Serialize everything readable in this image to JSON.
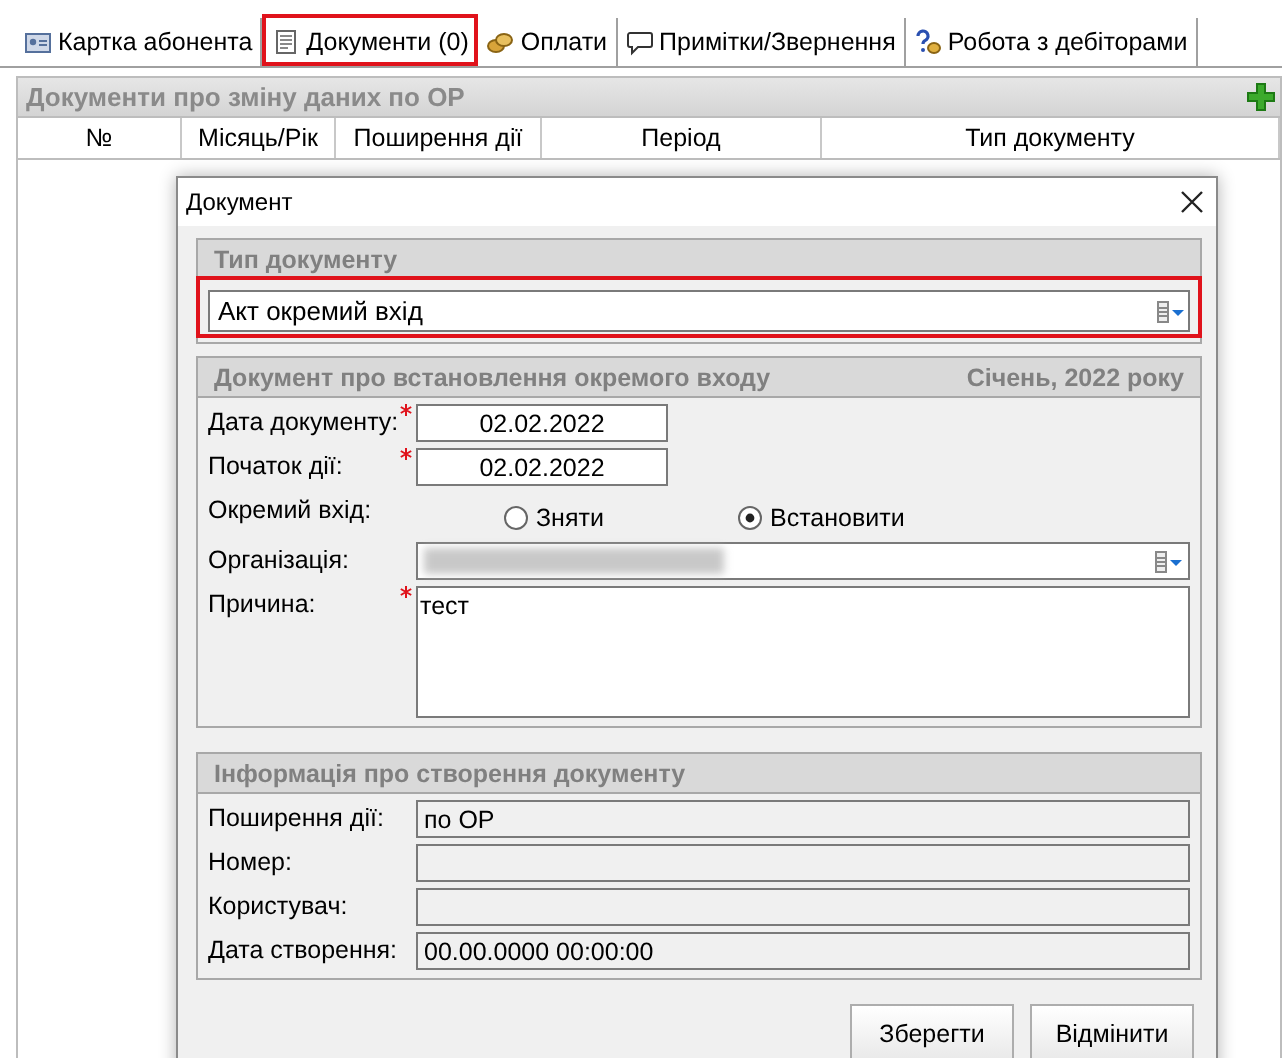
{
  "tabs": [
    {
      "label": "Картка абонента",
      "selected": false,
      "highlighted": false
    },
    {
      "label": "Документи (0)",
      "selected": true,
      "highlighted": true
    },
    {
      "label": "Оплати",
      "selected": false,
      "highlighted": false
    },
    {
      "label": "Примітки/Звернення",
      "selected": false,
      "highlighted": false
    },
    {
      "label": "Робота з дебіторами",
      "selected": false,
      "highlighted": false
    }
  ],
  "panel": {
    "title": "Документи про зміну даних по ОР",
    "columns": [
      "№",
      "Місяць/Рік",
      "Поширення дії",
      "Період",
      "Тип документу"
    ]
  },
  "dialog": {
    "title": "Документ",
    "type_section": {
      "title": "Тип документу",
      "value": "Акт окремий вхід",
      "highlighted": true
    },
    "doc_section": {
      "title": "Документ про встановлення окремого входу",
      "period": "Січень, 2022 року",
      "fields": [
        {
          "kind": "date",
          "label": "Дата документу:",
          "value": "02.02.2022",
          "required": true
        },
        {
          "kind": "date",
          "label": "Початок дії:",
          "value": "02.02.2022",
          "required": true
        },
        {
          "kind": "radio",
          "label": "Окремий вхід:",
          "options": [
            {
              "label": "Зняти",
              "selected": false
            },
            {
              "label": "Встановити",
              "selected": true
            }
          ]
        },
        {
          "kind": "combo",
          "label": "Організація:",
          "redacted": true
        },
        {
          "kind": "memo",
          "label": "Причина:",
          "value": "тест",
          "required": true
        }
      ]
    },
    "info_section": {
      "title": "Інформація про створення документу",
      "fields": [
        {
          "label": "Поширення дії:",
          "value": "по ОР"
        },
        {
          "label": "Номер:"
        },
        {
          "label": "Користувач:"
        },
        {
          "label": "Дата створення:",
          "value": "00.00.0000 00:00:00"
        }
      ]
    },
    "buttons": [
      "Зберегти",
      "Відмінити"
    ]
  }
}
